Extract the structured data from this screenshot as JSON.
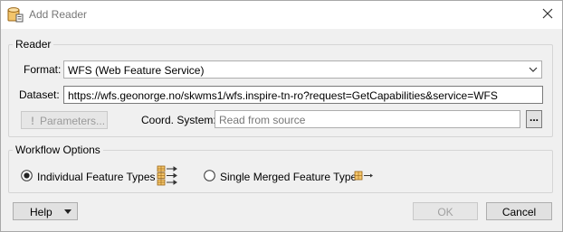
{
  "window": {
    "title": "Add Reader"
  },
  "reader": {
    "legend": "Reader",
    "format_label": "Format:",
    "format_value": "WFS (Web Feature Service)",
    "dataset_label": "Dataset:",
    "dataset_value": "https://wfs.geonorge.no/skwms1/wfs.inspire-tn-ro?request=GetCapabilities&service=WFS",
    "parameters_label": "Parameters...",
    "coord_label": "Coord. System:",
    "coord_placeholder": "Read from source",
    "ellipsis_label": "..."
  },
  "workflow": {
    "legend": "Workflow Options",
    "option_individual": "Individual Feature Types",
    "option_merged": "Single Merged Feature Type",
    "selected": "individual"
  },
  "buttons": {
    "help": "Help",
    "ok": "OK",
    "cancel": "Cancel"
  },
  "icons": {
    "app": "reader-icon",
    "close": "close-icon",
    "dropdown": "chevron-down-icon",
    "individual": "multiple-feature-types-icon",
    "merged": "single-feature-type-icon",
    "accent_icon_color": "#c07a1c"
  }
}
